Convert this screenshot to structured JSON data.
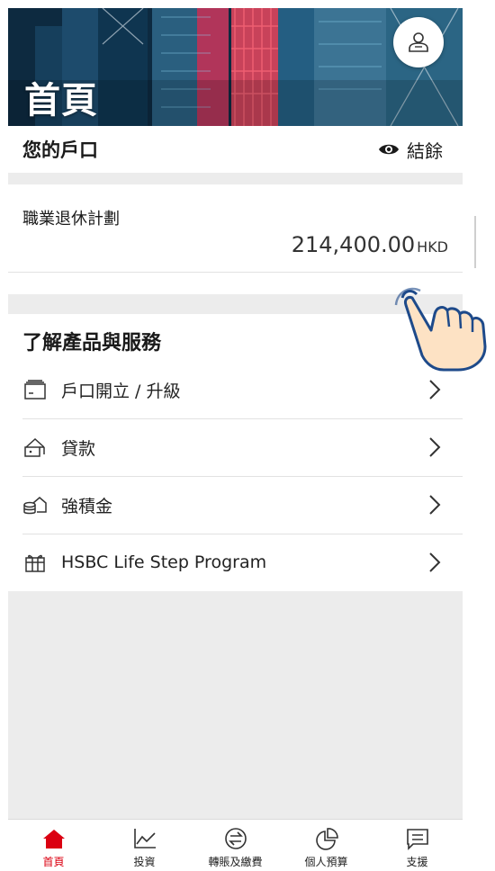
{
  "hero": {
    "title": "首頁",
    "profile_icon": "profile-icon"
  },
  "accounts": {
    "title": "您的戶口",
    "balance_label": "結餘",
    "balance_icon": "eye-icon",
    "items": [
      {
        "name": "職業退休計劃",
        "amount": "214,400.00",
        "currency": "HKD"
      }
    ]
  },
  "products": {
    "heading": "了解產品與服務",
    "items": [
      {
        "label": "戶口開立 / 升級",
        "icon": "wallet-icon"
      },
      {
        "label": "貸款",
        "icon": "loan-icon"
      },
      {
        "label": "強積金",
        "icon": "mpf-icon"
      },
      {
        "label": "HSBC Life Step Program",
        "icon": "gift-icon"
      }
    ]
  },
  "tabbar": {
    "items": [
      {
        "label": "首頁",
        "icon": "home-icon",
        "active": true
      },
      {
        "label": "投資",
        "icon": "chart-icon",
        "active": false
      },
      {
        "label": "轉賬及繳費",
        "icon": "transfer-icon",
        "active": false
      },
      {
        "label": "個人預算",
        "icon": "pie-chart-icon",
        "active": false
      },
      {
        "label": "支援",
        "icon": "message-icon",
        "active": false
      }
    ]
  },
  "colors": {
    "brand_red": "#db0011",
    "band_gray": "#ececec",
    "hand_fill": "#fde2c4",
    "hand_stroke": "#1e4a8a"
  }
}
